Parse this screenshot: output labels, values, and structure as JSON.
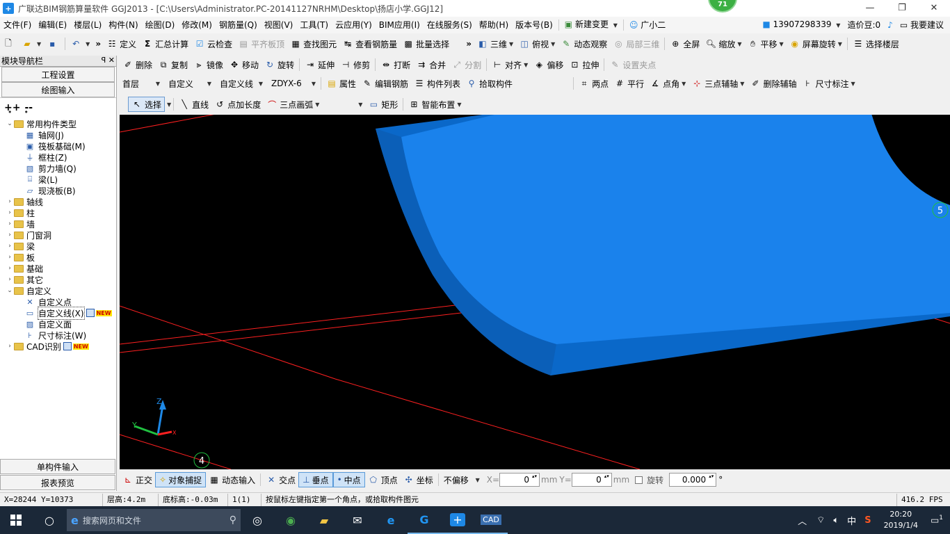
{
  "window": {
    "title": "广联达BIM钢筋算量软件 GGJ2013 - [C:\\Users\\Administrator.PC-20141127NRHM\\Desktop\\扬店小学.GGJ12]",
    "badge": "71",
    "controls": [
      "—",
      "❐",
      "✕"
    ]
  },
  "menu": {
    "items": [
      "文件(F)",
      "编辑(E)",
      "楼层(L)",
      "构件(N)",
      "绘图(D)",
      "修改(M)",
      "钢筋量(Q)",
      "视图(V)",
      "工具(T)",
      "云应用(Y)",
      "BIM应用(I)",
      "在线服务(S)",
      "帮助(H)",
      "版本号(B)"
    ],
    "new_change": "新建变更",
    "assistant": "广小二",
    "phone": "13907298339",
    "bean": "造价豆:0",
    "suggest": "我要建议"
  },
  "toolbar1": {
    "define": "定义",
    "sum": "汇总计算",
    "cloud_check": "云检查",
    "flush_slab": "平齐板顶",
    "find_elem": "查找图元",
    "view_rebar": "查看钢筋量",
    "batch_select": "批量选择",
    "view3d": "三维",
    "top_view": "俯视",
    "dynamic": "动态观察",
    "local3d": "局部三维",
    "fullscreen": "全屏",
    "zoom": "缩放",
    "pan": "平移",
    "rotate_screen": "屏幕旋转",
    "select_floor": "选择楼层"
  },
  "toolbar2": {
    "delete": "删除",
    "copy": "复制",
    "mirror": "镜像",
    "move": "移动",
    "rotate": "旋转",
    "extend": "延伸",
    "trim": "修剪",
    "break": "打断",
    "merge": "合并",
    "split": "分割",
    "align": "对齐",
    "offset": "偏移",
    "stretch": "拉伸",
    "set_grip": "设置夹点"
  },
  "toolbar3": {
    "floor": "首层",
    "category": "自定义",
    "type": "自定义线",
    "name": "ZDYX-6",
    "props": "属性",
    "edit_rebar": "编辑钢筋",
    "elem_list": "构件列表",
    "pick": "拾取构件",
    "two_points": "两点",
    "parallel": "平行",
    "point_angle": "点角",
    "three_point_axis": "三点辅轴",
    "del_axis": "删除辅轴",
    "dim": "尺寸标注"
  },
  "toolbar4": {
    "select": "选择",
    "line": "直线",
    "point_len": "点加长度",
    "arc3": "三点画弧",
    "rect": "矩形",
    "smart": "智能布置"
  },
  "sidebar": {
    "title": "模块导航栏",
    "pin": "ꟼ  ✕",
    "project_settings": "工程设置",
    "drawing_input": "绘图输入",
    "tree": [
      {
        "label": "常用构件类型",
        "level": 0,
        "type": "folder",
        "expanded": true
      },
      {
        "label": "轴网(J)",
        "level": 1,
        "icon": "grid"
      },
      {
        "label": "筏板基础(M)",
        "level": 1,
        "icon": "raft"
      },
      {
        "label": "框柱(Z)",
        "level": 1,
        "icon": "column"
      },
      {
        "label": "剪力墙(Q)",
        "level": 1,
        "icon": "wall"
      },
      {
        "label": "梁(L)",
        "level": 1,
        "icon": "beam"
      },
      {
        "label": "现浇板(B)",
        "level": 1,
        "icon": "slab"
      },
      {
        "label": "轴线",
        "level": 0,
        "type": "folder"
      },
      {
        "label": "柱",
        "level": 0,
        "type": "folder"
      },
      {
        "label": "墙",
        "level": 0,
        "type": "folder"
      },
      {
        "label": "门窗洞",
        "level": 0,
        "type": "folder"
      },
      {
        "label": "梁",
        "level": 0,
        "type": "folder"
      },
      {
        "label": "板",
        "level": 0,
        "type": "folder"
      },
      {
        "label": "基础",
        "level": 0,
        "type": "folder"
      },
      {
        "label": "其它",
        "level": 0,
        "type": "folder"
      },
      {
        "label": "自定义",
        "level": 0,
        "type": "folder",
        "expanded": true
      },
      {
        "label": "自定义点",
        "level": 1,
        "icon": "point"
      },
      {
        "label": "自定义线(X)",
        "level": 1,
        "icon": "line",
        "new": true,
        "selected": true
      },
      {
        "label": "自定义面",
        "level": 1,
        "icon": "face"
      },
      {
        "label": "尺寸标注(W)",
        "level": 1,
        "icon": "dim"
      },
      {
        "label": "CAD识别",
        "level": 0,
        "type": "folder",
        "new": true
      }
    ],
    "new_label": "NEW",
    "single_input": "单构件输入",
    "report": "报表预览"
  },
  "viewport": {
    "axis_labels": {
      "z": "Z",
      "y": "Y",
      "x": "X"
    },
    "grid_markers": [
      "5",
      "4"
    ]
  },
  "status": {
    "ortho": "正交",
    "snap": "对象捕捉",
    "dyn_input": "动态输入",
    "intersect": "交点",
    "perp": "垂点",
    "mid": "中点",
    "vertex": "顶点",
    "coord": "坐标",
    "offset_mode": "不偏移",
    "x_label": "X=",
    "x_val": "0",
    "y_label": "Y=",
    "y_val": "0",
    "mm": "mm",
    "rotate": "旋转",
    "rotate_val": "0.000",
    "degree": "°"
  },
  "info": {
    "coords": "X=28244 Y=10373",
    "floor_height": "层高:4.2m",
    "bottom_elev": "底标高:-0.03m",
    "count": "1(1)",
    "prompt": "按鼠标左键指定第一个角点，或拾取构件图元",
    "fps": "416.2 FPS"
  },
  "taskbar": {
    "search": "搜索网页和文件",
    "ime": "中",
    "time": "20:20",
    "date": "2019/1/4",
    "notify": "1"
  }
}
